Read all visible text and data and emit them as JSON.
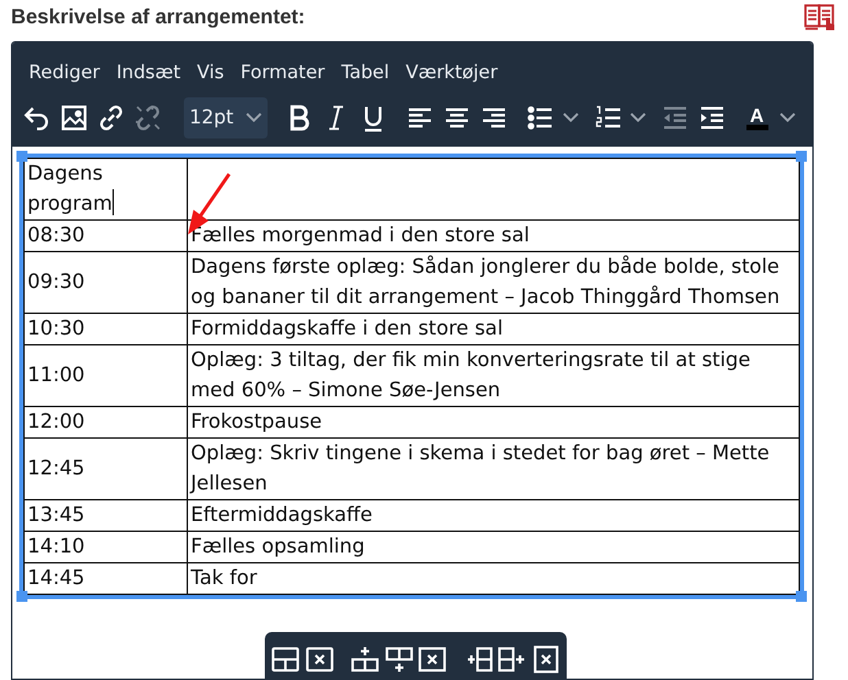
{
  "field_label": "Beskrivelse af arrangementet:",
  "menubar": [
    "Rediger",
    "Indsæt",
    "Vis",
    "Formater",
    "Tabel",
    "Værktøjer"
  ],
  "toolbar": {
    "font_size": "12pt",
    "text_color_letter": "A",
    "buttons": [
      {
        "kind": "undo",
        "disabled": false
      },
      {
        "kind": "image",
        "disabled": false
      },
      {
        "kind": "link",
        "disabled": false
      },
      {
        "kind": "unlink",
        "disabled": true
      },
      {
        "kind": "fontsize"
      },
      {
        "kind": "bold",
        "disabled": false
      },
      {
        "kind": "italic",
        "disabled": false
      },
      {
        "kind": "underline",
        "disabled": false
      },
      {
        "kind": "alignleft",
        "disabled": false
      },
      {
        "kind": "aligncenter",
        "disabled": false
      },
      {
        "kind": "alignright",
        "disabled": false
      },
      {
        "kind": "bullist",
        "disabled": false
      },
      {
        "kind": "numlist",
        "disabled": false
      },
      {
        "kind": "outdent",
        "disabled": true
      },
      {
        "kind": "indent",
        "disabled": false
      },
      {
        "kind": "textcolor",
        "disabled": false
      }
    ]
  },
  "table": {
    "rows": [
      {
        "time": "Dagens program",
        "has_caret": true
      },
      {
        "time": "08:30",
        "text": "Fælles morgenmad i den store sal",
        "has_caret": false
      },
      {
        "time": "09:30",
        "text": "Dagens første oplæg: Sådan jonglerer du både bolde, stole og bananer til dit arrangement – Jacob Thinggård Thomsen",
        "has_caret": false
      },
      {
        "time": "10:30",
        "text": "Formiddagskaffe i den store sal",
        "has_caret": false
      },
      {
        "time": "11:00",
        "text": "Oplæg: 3 tiltag, der fik min konverteringsrate til at stige med 60% – Simone Søe-Jensen",
        "has_caret": false
      },
      {
        "time": "12:00",
        "text": "Frokostpause",
        "has_caret": false
      },
      {
        "time": "12:45",
        "text": "Oplæg: Skriv tingene i skema i stedet for bag øret – Mette Jellesen",
        "has_caret": false
      },
      {
        "time": "13:45",
        "text": "Eftermiddagskaffe",
        "has_caret": false
      },
      {
        "time": "14:10",
        "text": "Fælles opsamling",
        "has_caret": false
      },
      {
        "time": "14:45",
        "text": "Tak for",
        "has_caret": false
      }
    ]
  },
  "table_toolbar": [
    {
      "kind": "table-props"
    },
    {
      "kind": "delete-table"
    },
    {
      "kind": "row-before"
    },
    {
      "kind": "row-after"
    },
    {
      "kind": "delete-row"
    },
    {
      "kind": "col-before"
    },
    {
      "kind": "col-after"
    },
    {
      "kind": "delete-col"
    }
  ]
}
